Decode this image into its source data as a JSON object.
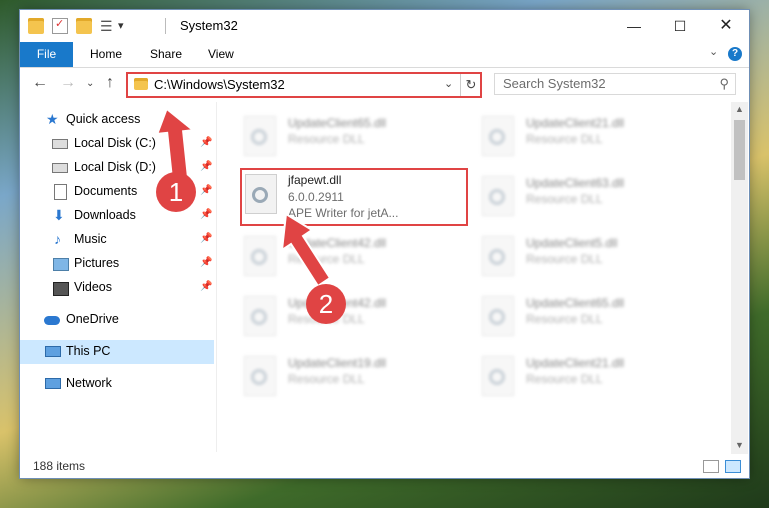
{
  "window": {
    "title": "System32",
    "quick_access_dropdown": "▾"
  },
  "ribbon": {
    "tabs": [
      "File",
      "Home",
      "Share",
      "View"
    ],
    "help": "?"
  },
  "address": {
    "path": "C:\\Windows\\System32",
    "search_placeholder": "Search System32"
  },
  "nav": {
    "items": [
      {
        "label": "Quick access",
        "icon": "star-icon"
      },
      {
        "label": "Local Disk (C:)",
        "icon": "drive-icon",
        "pinned": true
      },
      {
        "label": "Local Disk (D:)",
        "icon": "drive-icon",
        "pinned": true
      },
      {
        "label": "Documents",
        "icon": "documents-icon",
        "pinned": true
      },
      {
        "label": "Downloads",
        "icon": "downloads-icon",
        "pinned": true
      },
      {
        "label": "Music",
        "icon": "music-icon",
        "pinned": true
      },
      {
        "label": "Pictures",
        "icon": "pictures-icon",
        "pinned": true
      },
      {
        "label": "Videos",
        "icon": "videos-icon",
        "pinned": true
      },
      {
        "label": "OneDrive",
        "icon": "onedrive-icon"
      },
      {
        "label": "This PC",
        "icon": "pc-icon",
        "selected": true
      },
      {
        "label": "Network",
        "icon": "network-icon"
      }
    ]
  },
  "files": [
    {
      "name": "UpdateClient65.dll",
      "type": "Resource DLL"
    },
    {
      "name": "UpdateClient21.dll",
      "type": "Resource DLL"
    },
    {
      "name": "jfapewt.dll",
      "version": "6.0.0.2911",
      "description": "APE Writer for jetA...",
      "highlighted": true
    },
    {
      "name": "UpdateClient63.dll",
      "type": "Resource DLL"
    },
    {
      "name": "UpdateClient42.dll",
      "type": "Resource DLL"
    },
    {
      "name": "UpdateClient5.dll",
      "type": "Resource DLL"
    },
    {
      "name": "UpdateClient42.dll",
      "type": "Resource DLL"
    },
    {
      "name": "UpdateClient65.dll",
      "type": "Resource DLL"
    },
    {
      "name": "UpdateClient19.dll",
      "type": "Resource DLL"
    },
    {
      "name": "UpdateClient21.dll",
      "type": "Resource DLL"
    }
  ],
  "status": {
    "item_count": "188 items"
  },
  "annotations": {
    "step1": "1",
    "step2": "2",
    "color": "#e04444"
  }
}
